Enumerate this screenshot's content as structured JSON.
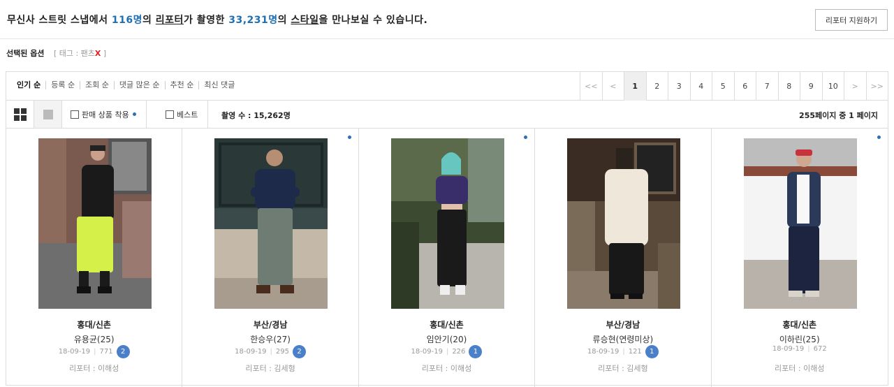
{
  "header": {
    "prefix": "무신사 스트릿 스냅에서 ",
    "reporter_count": "116명",
    "connector1": "의 ",
    "reporter_word": "리포터",
    "connector2": "가 촬영한 ",
    "style_count": "33,231명",
    "connector3": "의 ",
    "style_word": "스타일",
    "suffix": "을 만나보실 수 있습니다.",
    "apply_button": "리포터 지원하기"
  },
  "selected_options": {
    "label": "선택된 옵션",
    "tag_text": "[ 태그 : 팬츠",
    "remove": "X",
    "close": " ]"
  },
  "sort_options": [
    "인기 순",
    "등록 순",
    "조회 순",
    "댓글 많은 순",
    "추천 순",
    "최신 댓글"
  ],
  "pagination": {
    "first": "<<",
    "prev": "<",
    "pages": [
      "1",
      "2",
      "3",
      "4",
      "5",
      "6",
      "7",
      "8",
      "9",
      "10"
    ],
    "current": "1",
    "next": ">",
    "last": ">>"
  },
  "toolbar": {
    "product_checkbox": "판매 상품 착용",
    "best_checkbox": "베스트",
    "count_text": "촬영 수 : 15,262명",
    "page_info": "255페이지 중 1 페이지"
  },
  "cards": [
    {
      "region": "홍대/신촌",
      "name": "유용균(25)",
      "date": "18-09-19",
      "views": "771",
      "comments": "2",
      "reporter": "리포터 : 이해성",
      "new": false
    },
    {
      "region": "부산/경남",
      "name": "한승우(27)",
      "date": "18-09-19",
      "views": "295",
      "comments": "2",
      "reporter": "리포터 : 김세형",
      "new": true
    },
    {
      "region": "홍대/신촌",
      "name": "임안기(20)",
      "date": "18-09-19",
      "views": "226",
      "comments": "1",
      "reporter": "리포터 : 이해성",
      "new": true
    },
    {
      "region": "부산/경남",
      "name": "류승현(연령미상)",
      "date": "18-09-19",
      "views": "121",
      "comments": "1",
      "reporter": "리포터 : 김세형",
      "new": false
    },
    {
      "region": "홍대/신촌",
      "name": "이하린(25)",
      "date": "18-09-19",
      "views": "672",
      "comments": "",
      "reporter": "리포터 : 이해성",
      "new": true
    }
  ],
  "colors": {
    "accent": "#1f6fb2",
    "comment_badge": "#4a7fc9",
    "remove_x": "#e02020"
  }
}
